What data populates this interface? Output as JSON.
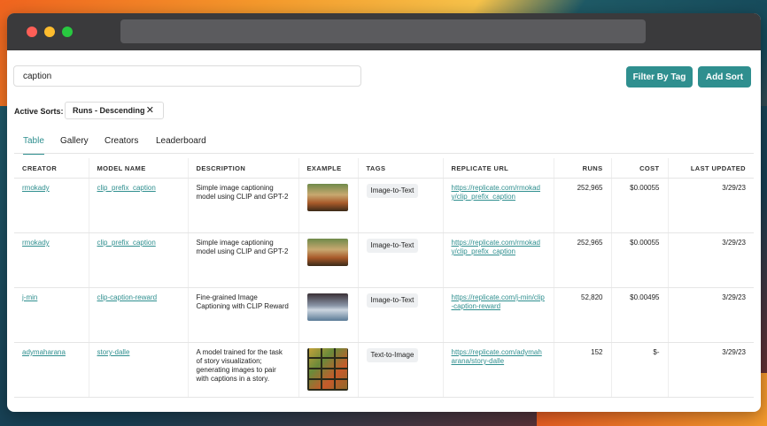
{
  "search": {
    "value": "caption"
  },
  "toolbar": {
    "filter_label": "Filter By Tag",
    "sort_label": "Add Sort"
  },
  "active_sorts": {
    "label": "Active Sorts:",
    "chip": "Runs - Descending",
    "remove_icon": "close-icon"
  },
  "tabs": [
    {
      "label": "Table",
      "active": true
    },
    {
      "label": "Gallery",
      "active": false
    },
    {
      "label": "Creators",
      "active": false
    },
    {
      "label": "Leaderboard",
      "active": false
    }
  ],
  "table": {
    "headers": [
      "CREATOR",
      "MODEL NAME",
      "DESCRIPTION",
      "EXAMPLE",
      "TAGS",
      "REPLICATE URL",
      "RUNS",
      "COST",
      "LAST UPDATED"
    ],
    "rows": [
      {
        "creator": "rmokady",
        "model": "clip_prefix_caption",
        "description": "Simple image captioning model using CLIP and GPT-2",
        "tag": "Image-to-Text",
        "url": "https://replicate.com/rmokady/clip_prefix_caption",
        "runs": "252,965",
        "cost": "$0.00055",
        "updated": "3/29/23"
      },
      {
        "creator": "rmokady",
        "model": "clip_prefix_caption",
        "description": "Simple image captioning model using CLIP and GPT-2",
        "tag": "Image-to-Text",
        "url": "https://replicate.com/rmokady/clip_prefix_caption",
        "runs": "252,965",
        "cost": "$0.00055",
        "updated": "3/29/23"
      },
      {
        "creator": "j-min",
        "model": "clip-caption-reward",
        "description": "Fine-grained Image Captioning with CLIP Reward",
        "tag": "Image-to-Text",
        "url": "https://replicate.com/j-min/clip-caption-reward",
        "runs": "52,820",
        "cost": "$0.00495",
        "updated": "3/29/23"
      },
      {
        "creator": "adymaharana",
        "model": "story-dalle",
        "description": "A model trained for the task of story visualization; generating images to pair with captions in a story.",
        "tag": "Text-to-Image",
        "url": "https://replicate.com/adymaharana/story-dalle",
        "runs": "152",
        "cost": "$-",
        "updated": "3/29/23"
      }
    ]
  },
  "colors": {
    "accent": "#2f8f8f",
    "titlebar": "#3a3a3c"
  }
}
